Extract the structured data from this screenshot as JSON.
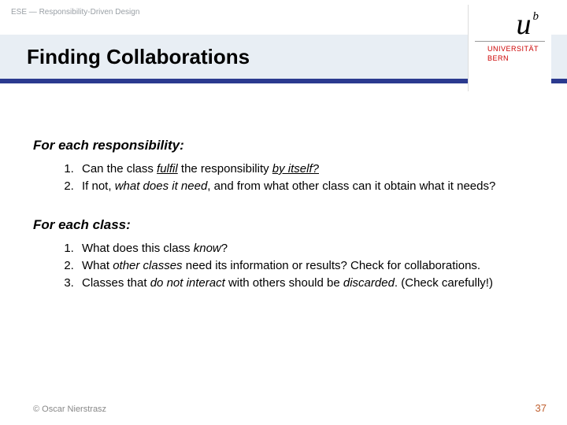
{
  "header": {
    "course_label": "ESE — Responsibility-Driven Design"
  },
  "title": "Finding Collaborations",
  "logo": {
    "mark_main": "u",
    "mark_sup": "b",
    "line1": "UNIVERSITÄT",
    "line2": "BERN"
  },
  "sections": [
    {
      "heading": "For each responsibility:",
      "items": [
        {
          "pre": "Can the class ",
          "em1": "fulfil",
          "mid": " the responsibility ",
          "em2": "by itself?",
          "post": ""
        },
        {
          "pre": "If not, ",
          "em1": "what does it need",
          "mid": ", and from what other class can it obtain what it needs?",
          "em2": "",
          "post": ""
        }
      ]
    },
    {
      "heading": "For each class:",
      "items": [
        {
          "pre": "What does this class ",
          "em1": "know",
          "mid": "?",
          "em2": "",
          "post": ""
        },
        {
          "pre": "What ",
          "em1": "other classes",
          "mid": " need its information or results? Check for collaborations.",
          "em2": "",
          "post": ""
        },
        {
          "pre": "Classes that ",
          "em1": "do not interact",
          "mid": " with others should be ",
          "em2": "discarded",
          "post": ". (Check carefully!)"
        }
      ]
    }
  ],
  "footer": {
    "copyright": "© Oscar Nierstrasz",
    "page": "37"
  }
}
